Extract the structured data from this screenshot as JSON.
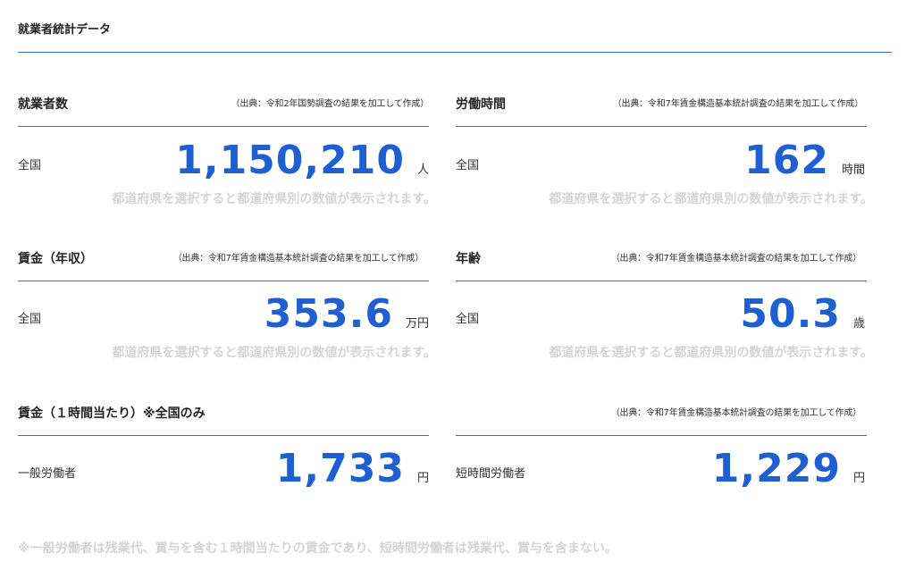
{
  "page": {
    "title": "就業者統計データ"
  },
  "cards": {
    "workers": {
      "title": "就業者数",
      "source": "（出典：令和2年国勢調査の結果を加工して作成）",
      "row_label": "全国",
      "value": "1,150,210",
      "unit": "人",
      "hint": "都道府県を選択すると都道府県別の数値が表示されます。"
    },
    "hours": {
      "title": "労働時間",
      "source": "（出典：令和7年賃金構造基本統計調査の結果を加工して作成）",
      "row_label": "全国",
      "value": "162",
      "unit": "時間",
      "hint": "都道府県を選択すると都道府県別の数値が表示されます。"
    },
    "wage_annual": {
      "title": "賃金（年収）",
      "source": "（出典：令和7年賃金構造基本統計調査の結果を加工して作成）",
      "row_label": "全国",
      "value": "353.6",
      "unit": "万円",
      "hint": "都道府県を選択すると都道府県別の数値が表示されます。"
    },
    "age": {
      "title": "年齢",
      "source": "（出典：令和7年賃金構造基本統計調査の結果を加工して作成）",
      "row_label": "全国",
      "value": "50.3",
      "unit": "歳",
      "hint": "都道府県を選択すると都道府県別の数値が表示されます。"
    },
    "wage_hourly_general": {
      "title": "賃金（１時間当たり）※全国のみ",
      "row_label": "一般労働者",
      "value": "1,733",
      "unit": "円"
    },
    "wage_hourly_short": {
      "source": "（出典：令和7年賃金構造基本統計調査の結果を加工して作成）",
      "row_label": "短時間労働者",
      "value": "1,229",
      "unit": "円"
    }
  },
  "footnote": "※一般労働者は残業代、賞与を含む１時間当たりの賃金であり、短時間労働者は残業代、賞与を含まない。",
  "colors": {
    "accent": "#1e5fd1",
    "rule_accent": "#2b6fd1",
    "hint": "#d4d4d4"
  }
}
